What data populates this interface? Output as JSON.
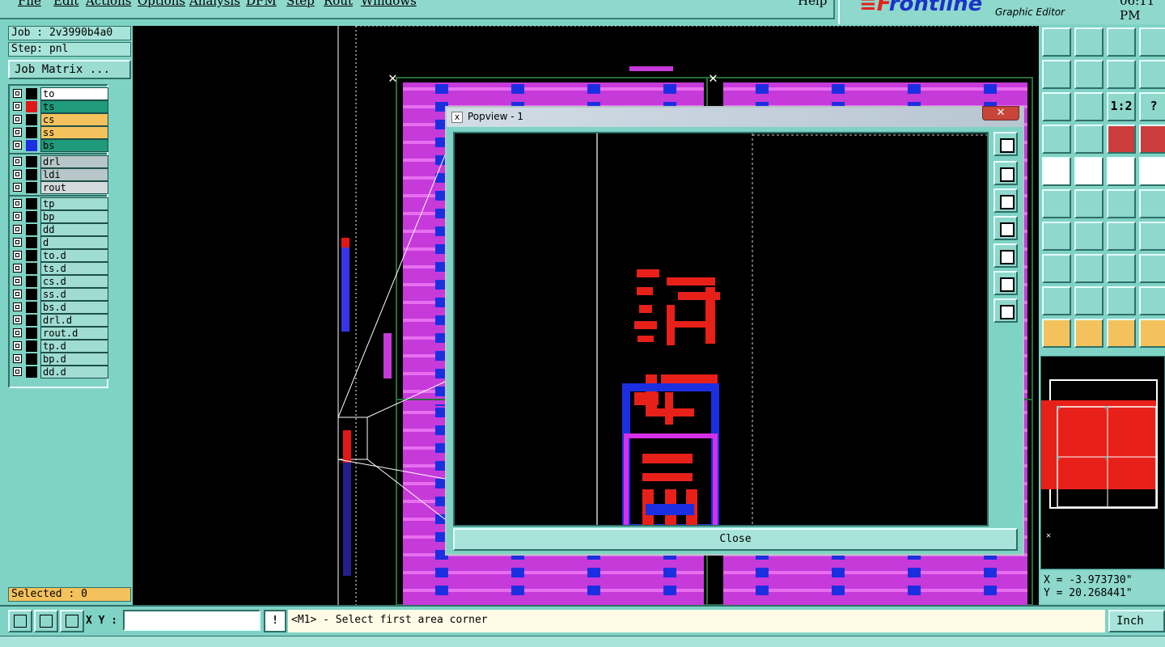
{
  "menu": {
    "items": [
      {
        "label": "File"
      },
      {
        "label": "Edit"
      },
      {
        "label": "Actions"
      },
      {
        "label": "Options"
      },
      {
        "label": "Analysis"
      },
      {
        "label": "DFM"
      },
      {
        "label": "Step"
      },
      {
        "label": "Rout"
      },
      {
        "label": "Windows"
      }
    ],
    "help": "Help"
  },
  "brand": {
    "logo_mark": "≡F",
    "logo_text": "rontline",
    "subtitle": "Graphic Editor",
    "clock": "06:11 PM"
  },
  "left": {
    "job": "Job : 2v3990b4a0",
    "step": "Step: pnl",
    "job_matrix": "Job Matrix ...",
    "layers": [
      {
        "name": "to",
        "color": "#000000",
        "bg": "#ffffff"
      },
      {
        "name": "ts",
        "color": "#e01818",
        "bg": "#1f9a7a"
      },
      {
        "name": "cs",
        "color": "#000000",
        "bg": "#f4c25c"
      },
      {
        "name": "ss",
        "color": "#000000",
        "bg": "#f4c25c"
      },
      {
        "name": "bs",
        "color": "#1c2fe0",
        "bg": "#1f9a7a"
      },
      {
        "name": "drl",
        "color": "#000000",
        "bg": "#b7c6c9"
      },
      {
        "name": "ldi",
        "color": "#000000",
        "bg": "#b7c6c9"
      },
      {
        "name": "rout",
        "color": "#000000",
        "bg": "#d4dada"
      },
      {
        "name": "tp",
        "color": "#000000",
        "bg": "#9fdcd2"
      },
      {
        "name": "bp",
        "color": "#000000",
        "bg": "#9fdcd2"
      },
      {
        "name": "dd",
        "color": "#000000",
        "bg": "#9fdcd2"
      },
      {
        "name": "d",
        "color": "#000000",
        "bg": "#9fdcd2"
      },
      {
        "name": "to.d",
        "color": "#000000",
        "bg": "#9fdcd2"
      },
      {
        "name": "ts.d",
        "color": "#000000",
        "bg": "#9fdcd2"
      },
      {
        "name": "cs.d",
        "color": "#000000",
        "bg": "#9fdcd2"
      },
      {
        "name": "ss.d",
        "color": "#000000",
        "bg": "#9fdcd2"
      },
      {
        "name": "bs.d",
        "color": "#000000",
        "bg": "#9fdcd2"
      },
      {
        "name": "drl.d",
        "color": "#000000",
        "bg": "#9fdcd2"
      },
      {
        "name": "rout.d",
        "color": "#000000",
        "bg": "#9fdcd2"
      },
      {
        "name": "tp.d",
        "color": "#000000",
        "bg": "#9fdcd2"
      },
      {
        "name": "bp.d",
        "color": "#000000",
        "bg": "#9fdcd2"
      },
      {
        "name": "dd.d",
        "color": "#000000",
        "bg": "#9fdcd2"
      }
    ],
    "selected": "Selected : 0"
  },
  "popview": {
    "title": "Popview - 1",
    "close_x": "✕",
    "close_button": "Close",
    "icon": "x"
  },
  "toolbox": {
    "labels": {
      "ratio": "1:2",
      "help": "?"
    }
  },
  "coords": {
    "x": "X = -3.973730\"",
    "y": "Y = 20.268441\""
  },
  "bottom": {
    "xy_label": "X Y :",
    "xy_value": "",
    "excl": "!",
    "prompt": "<M1> - Select first area corner",
    "units": "Inch"
  },
  "colors": {
    "accent": "#7fd3c4",
    "magenta": "#d430e8",
    "blue": "#1c2fe0",
    "red": "#e01818"
  }
}
